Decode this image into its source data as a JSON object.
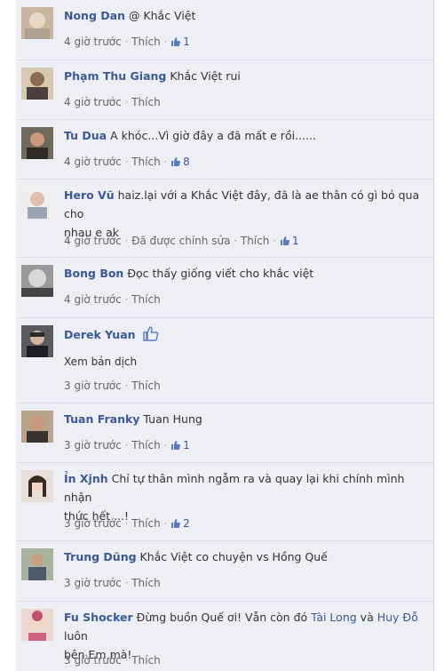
{
  "comments": [
    {
      "name": "Nong Dan",
      "text": "@ Khắc Việt",
      "time": "4 giờ trước",
      "like": "Thích",
      "likes": "1"
    },
    {
      "name": "Phạm Thu Giang",
      "text": "Khắc Việt rui",
      "time": "4 giờ trước",
      "like": "Thích"
    },
    {
      "name": "Tu Dua",
      "text": "A khóc...Vì giờ đây a đã mất e rồi......",
      "time": "4 giờ trước",
      "like": "Thích",
      "likes": "8"
    },
    {
      "name": "Hero Vũ",
      "text": "haiz.lại với a Khắc Việt đây, đã là ae thân có gì bỏ qua cho",
      "text2": "nhau e ak",
      "time": "4 giờ trước",
      "edited": "Đã được chỉnh sửa",
      "like": "Thích",
      "likes": "1"
    },
    {
      "name": "Bong Bon",
      "text": "Đọc thấy giống viết cho khắc việt",
      "time": "4 giờ trước",
      "like": "Thích"
    },
    {
      "name": "Derek Yuan",
      "translate": "Xem bản dịch",
      "time": "3 giờ trước",
      "like": "Thích"
    },
    {
      "name": "Tuan Franky",
      "text": "Tuan Hung",
      "time": "3 giờ trước",
      "like": "Thích",
      "likes": "1"
    },
    {
      "name": "Ỉn Xjnh",
      "text": "Chỉ tự thân mình ngẫm ra và quay lại khi chính mình nhận",
      "text2": "thức hết ...!",
      "time": "3 giờ trước",
      "like": "Thích",
      "likes": "2"
    },
    {
      "name": "Trung Dũng",
      "text": "Khắc Việt co chuyện vs Hồng Quế",
      "time": "3 giờ trước",
      "like": "Thích"
    },
    {
      "name": "Fu Shocker",
      "text_a": "Đừng buồn Quế ơi! Vẫn còn đó",
      "link1": "Tài Long",
      "text_b": "và",
      "link2": "Huy Đỗ",
      "text_c": "luôn",
      "text2": "bên Em mà!",
      "time": "3 giờ trước",
      "like": "Thích"
    }
  ],
  "colors": {
    "link": "#3b5998",
    "meta": "#666666",
    "bg": "#edeff4"
  },
  "icons": {
    "like": "thumbs-up-icon"
  }
}
